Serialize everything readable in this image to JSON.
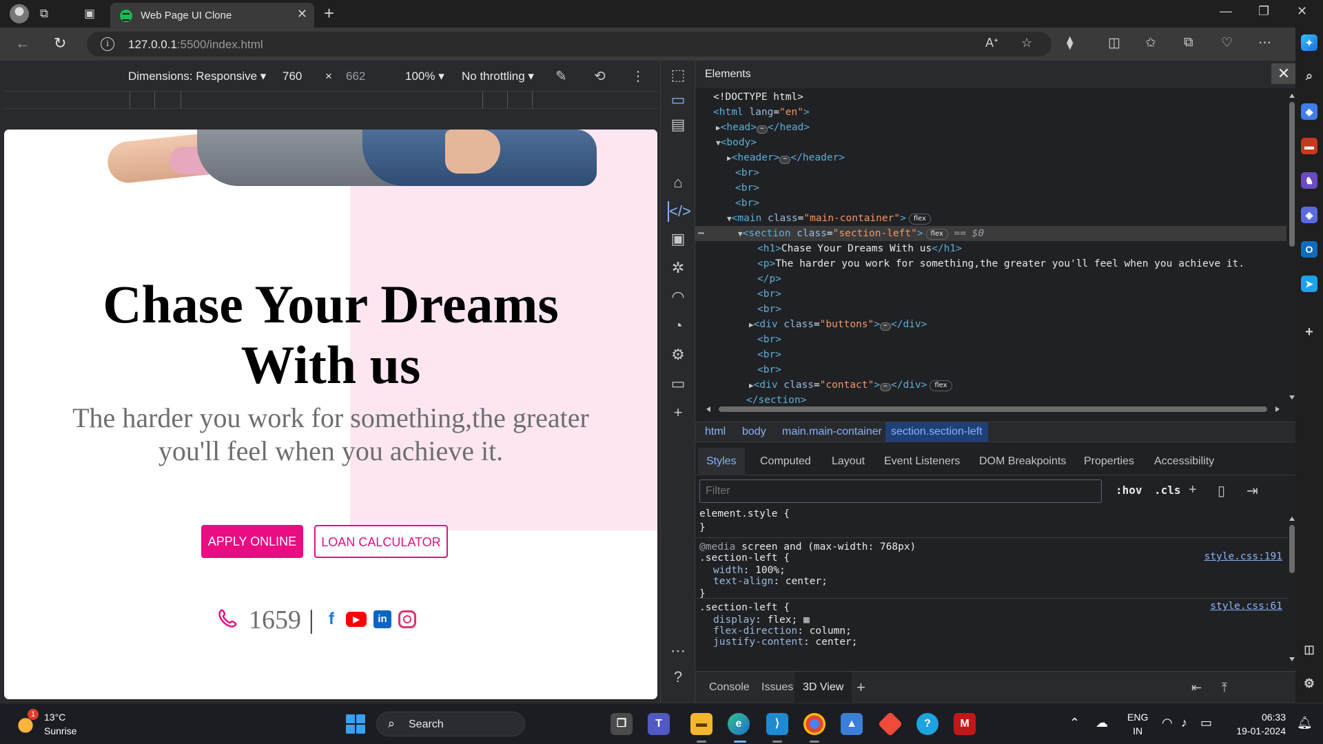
{
  "browser": {
    "tab_title": "Web Page UI Clone",
    "url_host": "127.0.0.1",
    "url_rest": ":5500/index.html"
  },
  "device_toolbar": {
    "dimensions_label": "Dimensions: Responsive ▾",
    "width": "760",
    "times": "×",
    "height": "662",
    "zoom": "100% ▾",
    "throttling": "No throttling ▾"
  },
  "page": {
    "title_line1": "Chase Your Dreams",
    "title_line2": "With us",
    "text_line1": "The harder you work for something,the greater",
    "text_line2": "you'll feel when you achieve it.",
    "apply_label": "APPLY ONLINE",
    "loan_label": "LOAN CALCULATOR",
    "phone_number": "1659",
    "separator": "|",
    "accent_color": "#ea0c82"
  },
  "devtools": {
    "panel_title": "Elements",
    "dom": {
      "doctype": "<!DOCTYPE html>",
      "html_open": "<html",
      "lang_attr": "lang",
      "lang_val": "\"en\"",
      "head": "<head>",
      "head_close": "</head>",
      "body": "<body>",
      "header": "<header>",
      "header_close": "</header>",
      "br": "<br>",
      "main_open": "<main",
      "main_class_val": "\"main-container\"",
      "section_open": "<section",
      "section_class_val": "\"section-left\"",
      "flex_pill": "flex",
      "eq0": "== $0",
      "h1_open": "<h1>",
      "h1_text": "Chase Your Dreams With us",
      "h1_close": "</h1>",
      "p_open": "<p>",
      "p_text": "The harder you work for something,the greater you'll feel when you achieve it.",
      "p_close": "</p>",
      "div_open": "<div",
      "buttons_val": "\"buttons\"",
      "div_close": "</div>",
      "contact_val": "\"contact\"",
      "section_close": "</section>",
      "class_attr": "class",
      "gt": ">",
      "ellipsis": "⋯"
    },
    "breadcrumbs": [
      "html",
      "body",
      "main.main-container",
      "section.section-left"
    ],
    "style_tabs": [
      "Styles",
      "Computed",
      "Layout",
      "Event Listeners",
      "DOM Breakpoints",
      "Properties",
      "Accessibility"
    ],
    "filter_placeholder": "Filter",
    "hov": ":hov",
    "cls": ".cls",
    "styles": {
      "element_style": "element.style {",
      "close_brace": "}",
      "media_kw": "@media",
      "media_rule": " screen and (max-width: 768px)",
      "section_left_sel": ".section-left {",
      "width_name": "width",
      "width_val": ": 100%;",
      "ta_name": "text-align",
      "ta_val": ": center;",
      "src1": "style.css:191",
      "src2": "style.css:61",
      "display_name": "display",
      "display_val": ": flex;",
      "fd_name": "flex-direction",
      "fd_val": ": column;",
      "jc_name": "justify-content",
      "jc_val": ": center;"
    },
    "drawer_tabs": [
      "Console",
      "Issues",
      "3D View"
    ]
  },
  "taskbar": {
    "weather_badge": "1",
    "temperature": "13°C",
    "weather_desc": "Sunrise",
    "search_label": "Search",
    "lang_top": "ENG",
    "lang_bottom": "IN",
    "time": "06:33",
    "date": "19-01-2024"
  }
}
